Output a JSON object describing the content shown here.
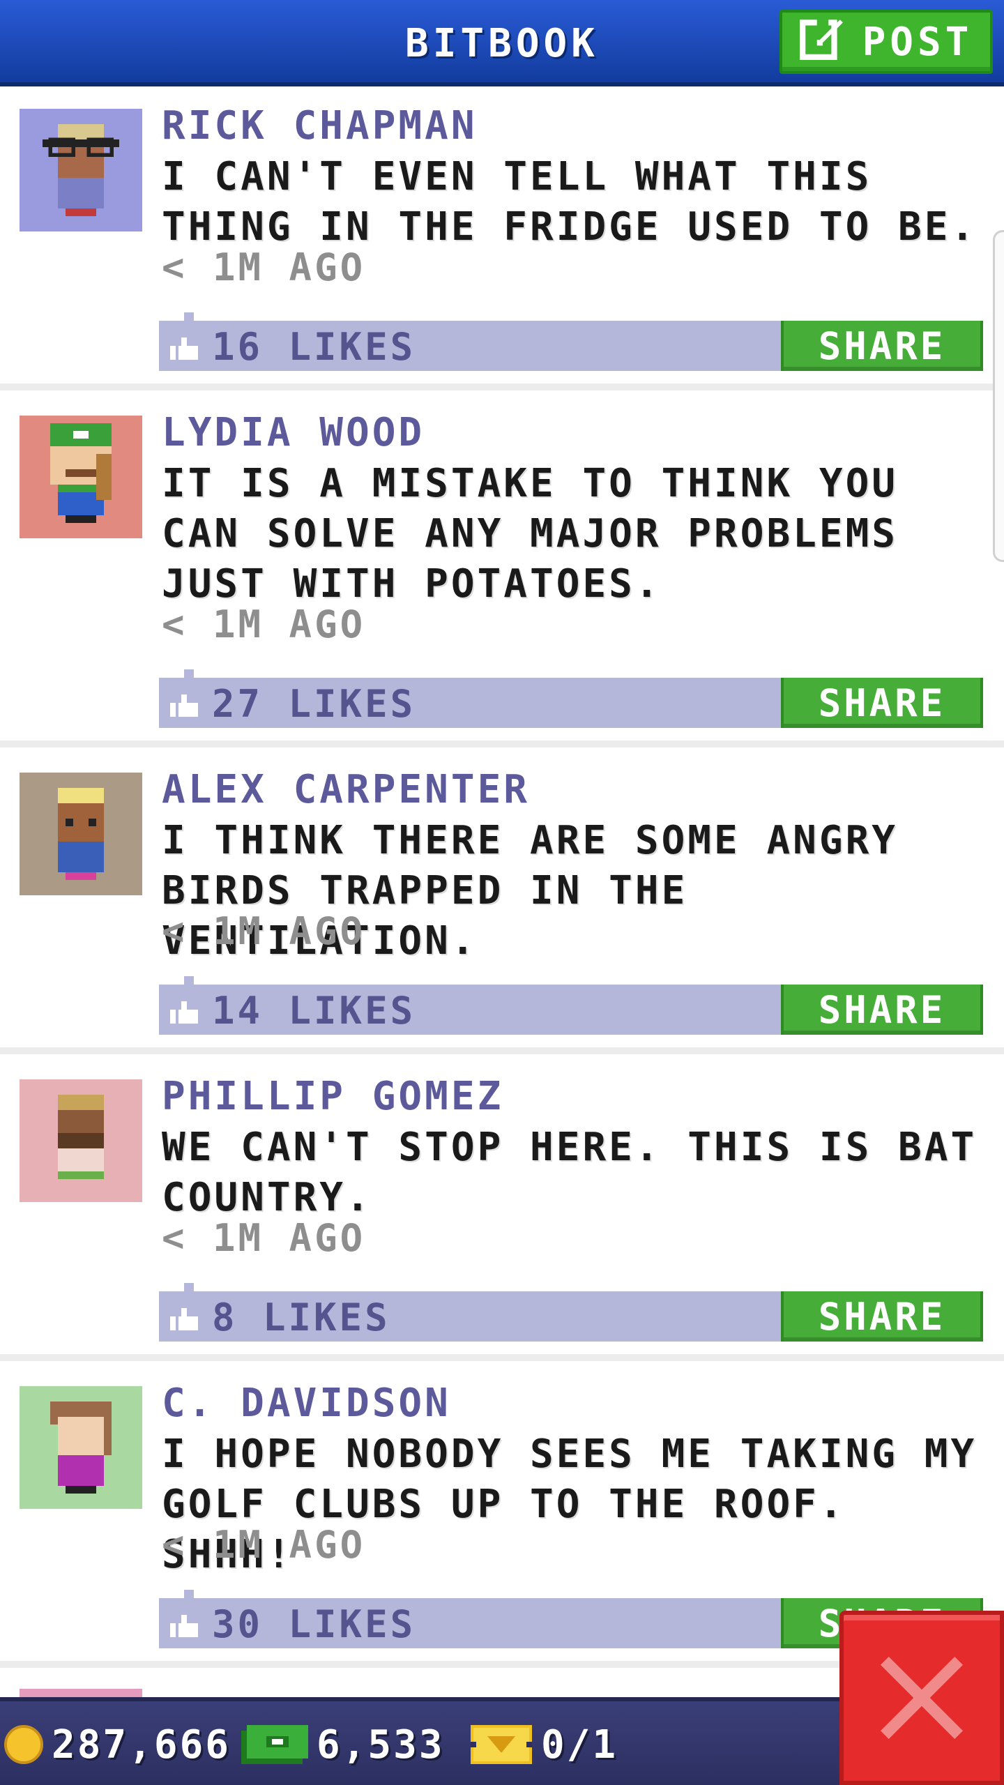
{
  "header": {
    "title": "BITBOOK",
    "post_label": "POST"
  },
  "posts": [
    {
      "author": "RICK CHAPMAN",
      "message": "I CAN'T EVEN TELL WHAT THIS THING IN THE FRIDGE USED TO BE.",
      "time": "< 1M AGO",
      "likes": "16 LIKES",
      "share": "SHARE",
      "avatar_bg": "#9a9bde"
    },
    {
      "author": "LYDIA WOOD",
      "message": "IT IS A MISTAKE TO THINK YOU CAN SOLVE ANY MAJOR PROBLEMS JUST WITH POTATOES.",
      "time": "< 1M AGO",
      "likes": "27 LIKES",
      "share": "SHARE",
      "avatar_bg": "#e08a80"
    },
    {
      "author": "ALEX CARPENTER",
      "message": "I THINK THERE ARE SOME ANGRY BIRDS TRAPPED IN THE VENTILATION.",
      "time": "< 1M AGO",
      "likes": "14 LIKES",
      "share": "SHARE",
      "avatar_bg": "#ab9a86"
    },
    {
      "author": "PHILLIP GOMEZ",
      "message": "WE CAN'T STOP HERE. THIS IS BAT COUNTRY.",
      "time": "< 1M AGO",
      "likes": "8 LIKES",
      "share": "SHARE",
      "avatar_bg": "#e6b0b4"
    },
    {
      "author": "C. DAVIDSON",
      "message": "I HOPE NOBODY SEES ME TAKING MY GOLF CLUBS UP TO THE ROOF. SHHH!",
      "time": "< 1M AGO",
      "likes": "30 LIKES",
      "share": "SHARE",
      "avatar_bg": "#a9d8a0"
    }
  ],
  "bottom_bar": {
    "coins": "287,666",
    "bux": "6,533",
    "vip": "0/1"
  },
  "colors": {
    "header": "#1f4fc4",
    "post_button": "#3fb52e",
    "likes_bar": "#b4b6da",
    "share_button": "#46ad38",
    "close_button": "#e52b2b",
    "bottom_bar": "#34386c"
  },
  "icons": {
    "post": "edit-icon",
    "like": "thumbs-up-icon",
    "coin": "coin-icon",
    "bux": "bux-icon",
    "vip": "vip-ticket-icon",
    "close": "close-icon"
  }
}
